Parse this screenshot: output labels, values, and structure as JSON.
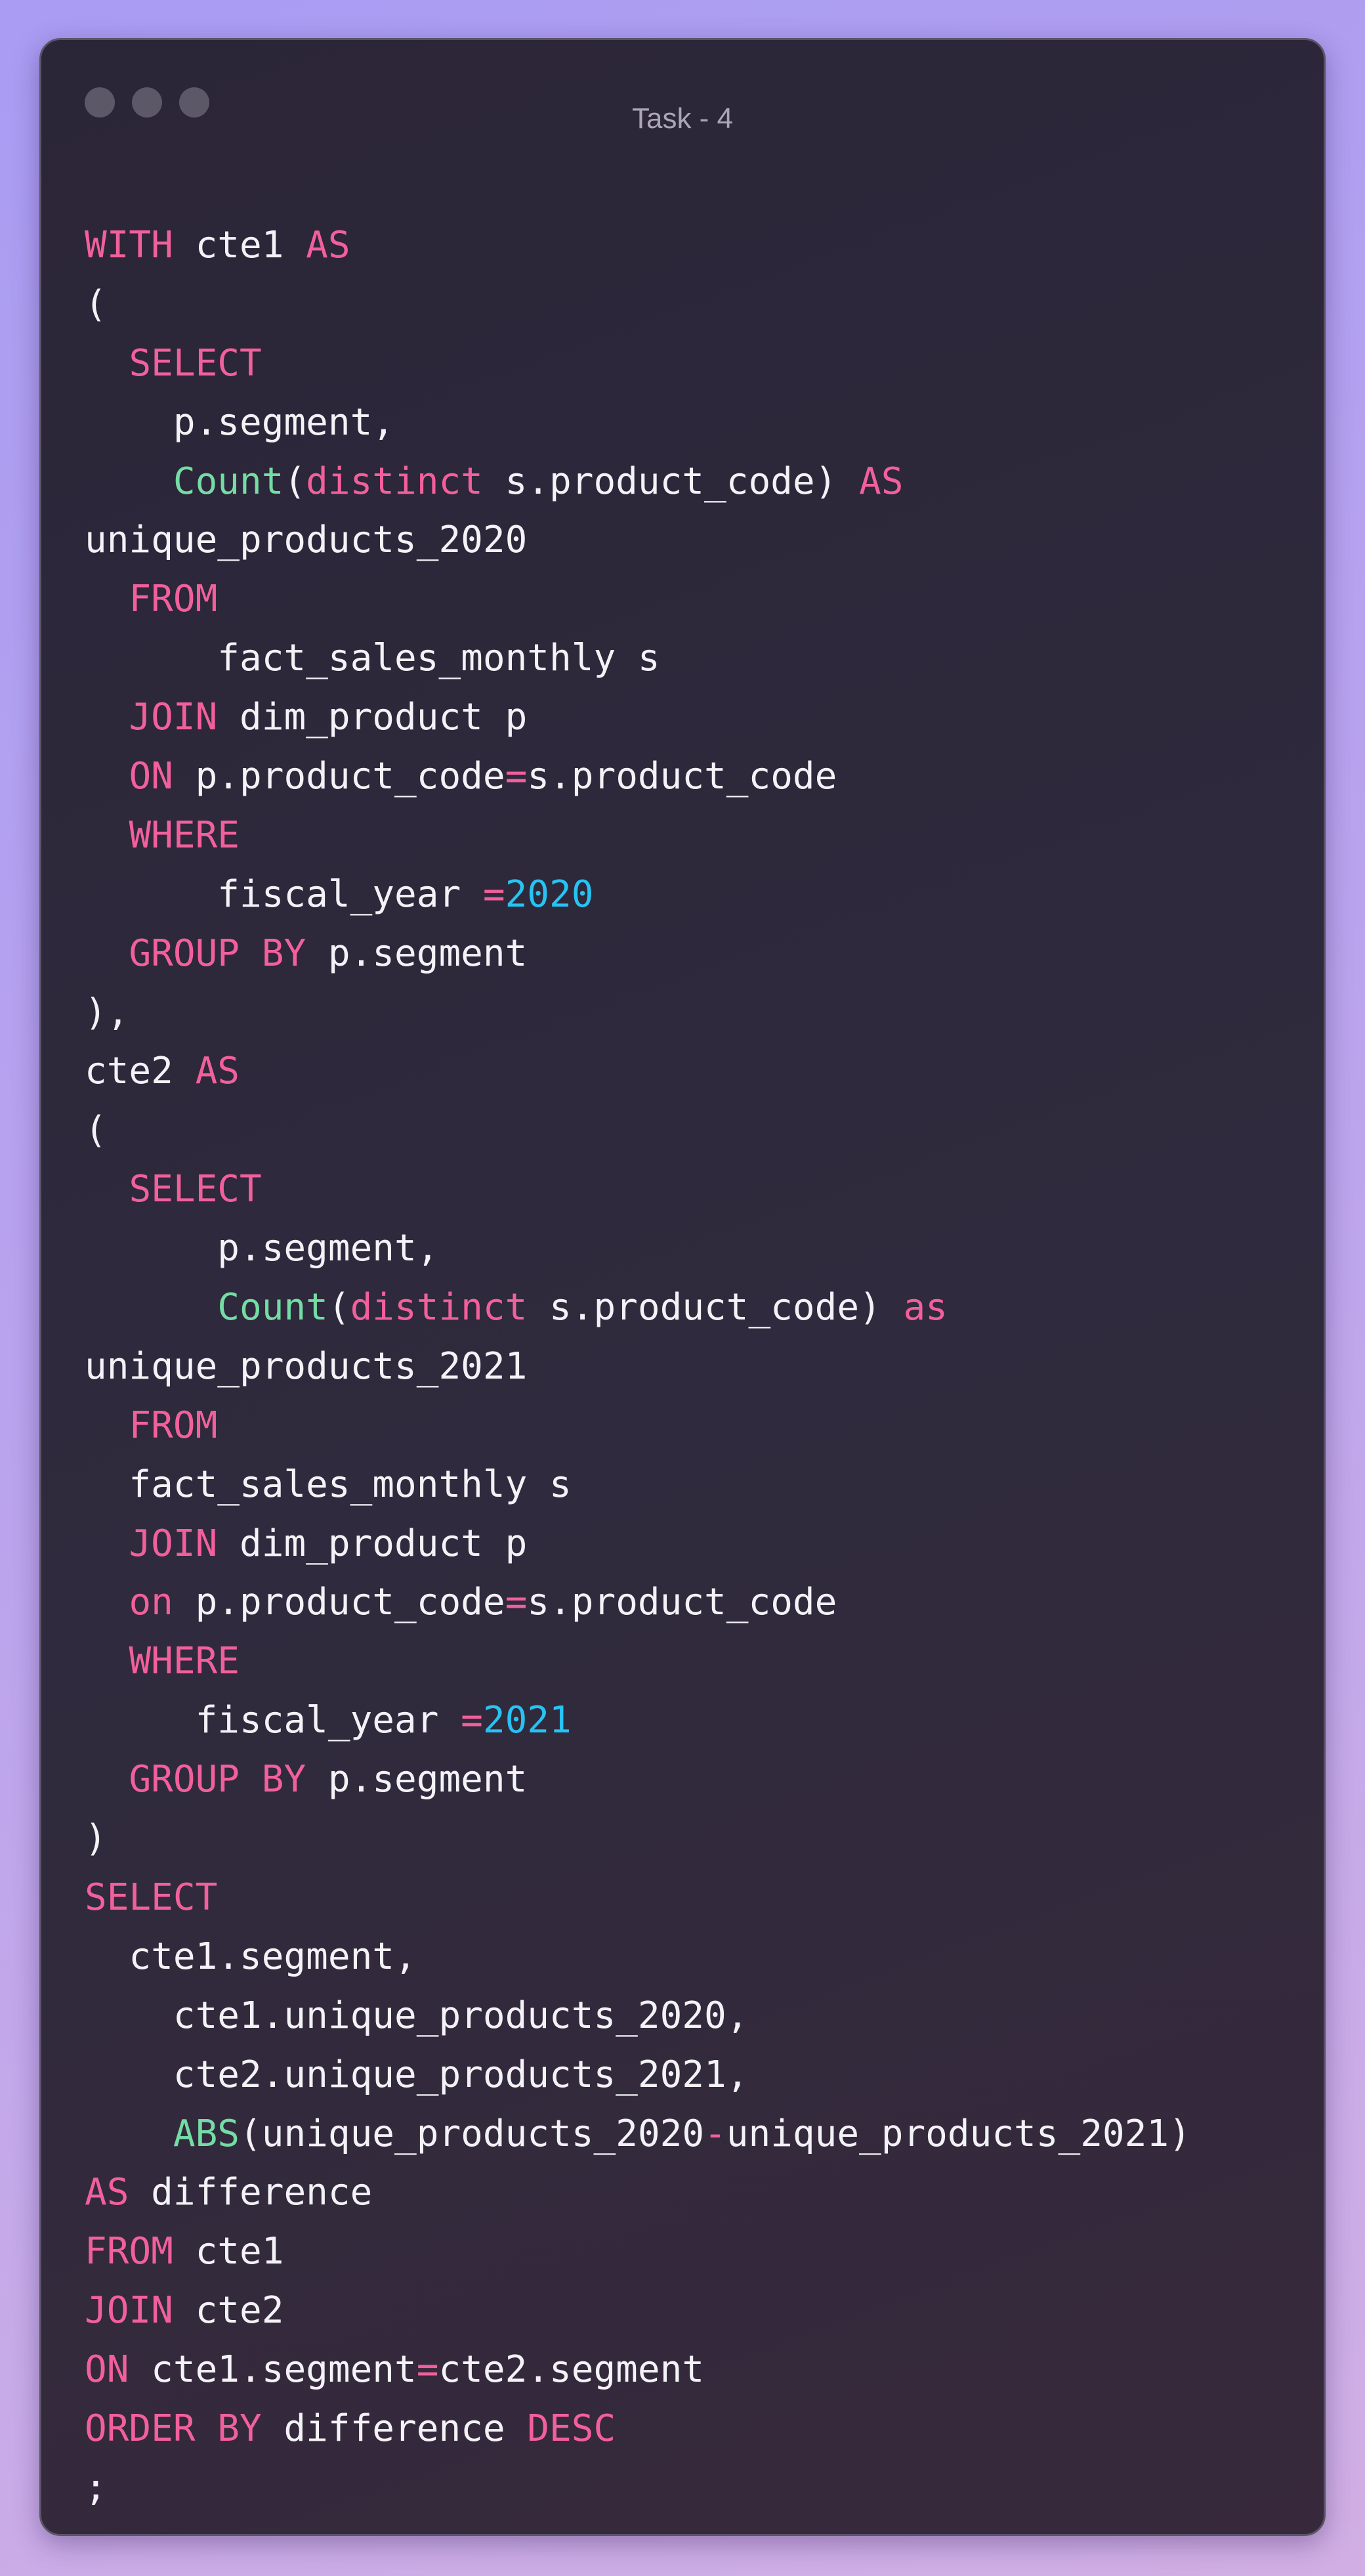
{
  "window": {
    "title": "Task - 4"
  },
  "colors": {
    "keyword": "#f2609c",
    "function": "#74dca4",
    "number": "#27c3f2",
    "text": "#f3f2f6",
    "window_bg": "#2f2a3d",
    "traffic_light": "#5c5868"
  },
  "code": {
    "language": "SQL",
    "lines": [
      [
        {
          "t": "kw",
          "v": "WITH"
        },
        {
          "t": "plain",
          "v": " cte1 "
        },
        {
          "t": "kw",
          "v": "AS"
        }
      ],
      [
        {
          "t": "plain",
          "v": "("
        }
      ],
      [
        {
          "t": "plain",
          "v": "  "
        },
        {
          "t": "kw",
          "v": "SELECT"
        }
      ],
      [
        {
          "t": "plain",
          "v": "    p.segment,"
        }
      ],
      [
        {
          "t": "plain",
          "v": "    "
        },
        {
          "t": "fn",
          "v": "Count"
        },
        {
          "t": "plain",
          "v": "("
        },
        {
          "t": "kw",
          "v": "distinct"
        },
        {
          "t": "plain",
          "v": " s.product_code) "
        },
        {
          "t": "kw",
          "v": "AS"
        }
      ],
      [
        {
          "t": "plain",
          "v": "unique_products_2020"
        }
      ],
      [
        {
          "t": "plain",
          "v": "  "
        },
        {
          "t": "kw",
          "v": "FROM"
        }
      ],
      [
        {
          "t": "plain",
          "v": "      fact_sales_monthly s"
        }
      ],
      [
        {
          "t": "plain",
          "v": "  "
        },
        {
          "t": "kw",
          "v": "JOIN"
        },
        {
          "t": "plain",
          "v": " dim_product p"
        }
      ],
      [
        {
          "t": "plain",
          "v": "  "
        },
        {
          "t": "kw",
          "v": "ON"
        },
        {
          "t": "plain",
          "v": " p.product_code"
        },
        {
          "t": "op",
          "v": "="
        },
        {
          "t": "plain",
          "v": "s.product_code"
        }
      ],
      [
        {
          "t": "plain",
          "v": "  "
        },
        {
          "t": "kw",
          "v": "WHERE"
        }
      ],
      [
        {
          "t": "plain",
          "v": "      fiscal_year "
        },
        {
          "t": "op",
          "v": "="
        },
        {
          "t": "num",
          "v": "2020"
        }
      ],
      [
        {
          "t": "plain",
          "v": "  "
        },
        {
          "t": "kw",
          "v": "GROUP BY"
        },
        {
          "t": "plain",
          "v": " p.segment"
        }
      ],
      [
        {
          "t": "plain",
          "v": "),"
        }
      ],
      [
        {
          "t": "plain",
          "v": "cte2 "
        },
        {
          "t": "kw",
          "v": "AS"
        }
      ],
      [
        {
          "t": "plain",
          "v": "("
        }
      ],
      [
        {
          "t": "plain",
          "v": "  "
        },
        {
          "t": "kw",
          "v": "SELECT"
        }
      ],
      [
        {
          "t": "plain",
          "v": "      p.segment,"
        }
      ],
      [
        {
          "t": "plain",
          "v": "      "
        },
        {
          "t": "fn",
          "v": "Count"
        },
        {
          "t": "plain",
          "v": "("
        },
        {
          "t": "kw",
          "v": "distinct"
        },
        {
          "t": "plain",
          "v": " s.product_code) "
        },
        {
          "t": "kw",
          "v": "as"
        }
      ],
      [
        {
          "t": "plain",
          "v": "unique_products_2021"
        }
      ],
      [
        {
          "t": "plain",
          "v": "  "
        },
        {
          "t": "kw",
          "v": "FROM"
        }
      ],
      [
        {
          "t": "plain",
          "v": "  fact_sales_monthly s"
        }
      ],
      [
        {
          "t": "plain",
          "v": "  "
        },
        {
          "t": "kw",
          "v": "JOIN"
        },
        {
          "t": "plain",
          "v": " dim_product p"
        }
      ],
      [
        {
          "t": "plain",
          "v": "  "
        },
        {
          "t": "kw",
          "v": "on"
        },
        {
          "t": "plain",
          "v": " p.product_code"
        },
        {
          "t": "op",
          "v": "="
        },
        {
          "t": "plain",
          "v": "s.product_code"
        }
      ],
      [
        {
          "t": "plain",
          "v": "  "
        },
        {
          "t": "kw",
          "v": "WHERE"
        }
      ],
      [
        {
          "t": "plain",
          "v": "     fiscal_year "
        },
        {
          "t": "op",
          "v": "="
        },
        {
          "t": "num",
          "v": "2021"
        }
      ],
      [
        {
          "t": "plain",
          "v": "  "
        },
        {
          "t": "kw",
          "v": "GROUP BY"
        },
        {
          "t": "plain",
          "v": " p.segment"
        }
      ],
      [
        {
          "t": "plain",
          "v": ")"
        }
      ],
      [
        {
          "t": "kw",
          "v": "SELECT"
        }
      ],
      [
        {
          "t": "plain",
          "v": "  cte1.segment,"
        }
      ],
      [
        {
          "t": "plain",
          "v": "    cte1.unique_products_2020,"
        }
      ],
      [
        {
          "t": "plain",
          "v": "    cte2.unique_products_2021,"
        }
      ],
      [
        {
          "t": "plain",
          "v": "    "
        },
        {
          "t": "fn",
          "v": "ABS"
        },
        {
          "t": "plain",
          "v": "(unique_products_2020"
        },
        {
          "t": "op",
          "v": "-"
        },
        {
          "t": "plain",
          "v": "unique_products_2021)"
        }
      ],
      [
        {
          "t": "kw",
          "v": "AS"
        },
        {
          "t": "plain",
          "v": " difference"
        }
      ],
      [
        {
          "t": "kw",
          "v": "FROM"
        },
        {
          "t": "plain",
          "v": " cte1"
        }
      ],
      [
        {
          "t": "kw",
          "v": "JOIN"
        },
        {
          "t": "plain",
          "v": " cte2"
        }
      ],
      [
        {
          "t": "kw",
          "v": "ON"
        },
        {
          "t": "plain",
          "v": " cte1.segment"
        },
        {
          "t": "op",
          "v": "="
        },
        {
          "t": "plain",
          "v": "cte2.segment"
        }
      ],
      [
        {
          "t": "kw",
          "v": "ORDER BY"
        },
        {
          "t": "plain",
          "v": " difference "
        },
        {
          "t": "kw",
          "v": "DESC"
        }
      ],
      [
        {
          "t": "plain",
          "v": ";"
        }
      ]
    ]
  }
}
